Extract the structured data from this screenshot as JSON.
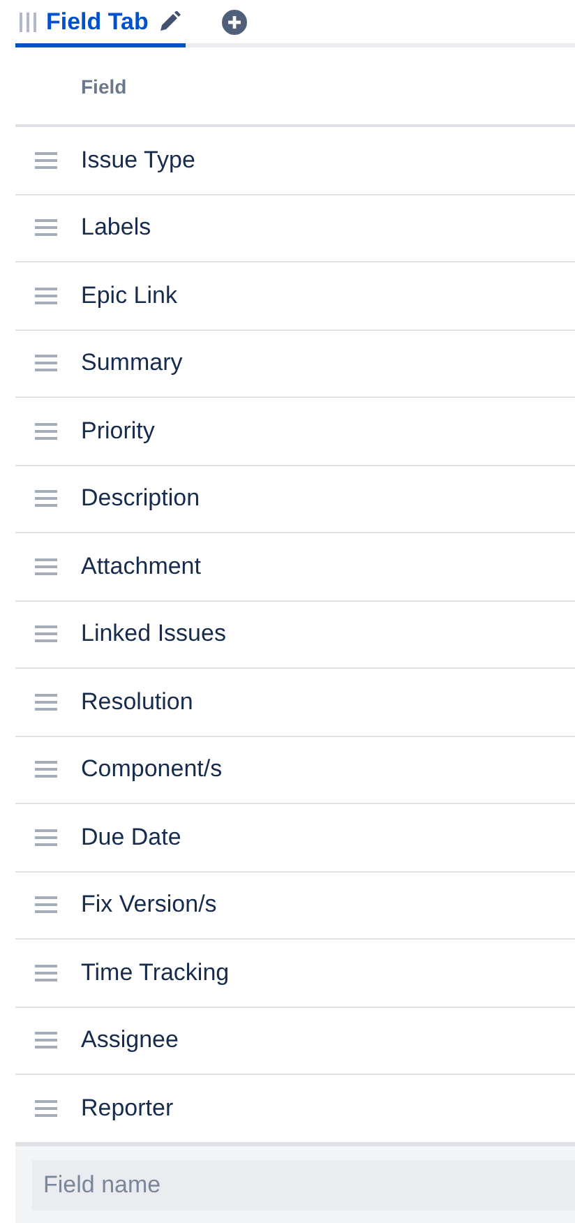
{
  "tabs": [
    {
      "label": "Field Tab",
      "selected": true
    }
  ],
  "table": {
    "columns": [
      "Field"
    ],
    "rows": [
      {
        "field": "Issue Type"
      },
      {
        "field": "Labels"
      },
      {
        "field": "Epic Link"
      },
      {
        "field": "Summary"
      },
      {
        "field": "Priority"
      },
      {
        "field": "Description"
      },
      {
        "field": "Attachment"
      },
      {
        "field": "Linked Issues"
      },
      {
        "field": "Resolution"
      },
      {
        "field": "Component/s"
      },
      {
        "field": "Due Date"
      },
      {
        "field": "Fix Version/s"
      },
      {
        "field": "Time Tracking"
      },
      {
        "field": "Assignee"
      },
      {
        "field": "Reporter"
      }
    ]
  },
  "search": {
    "placeholder": "Field name"
  }
}
